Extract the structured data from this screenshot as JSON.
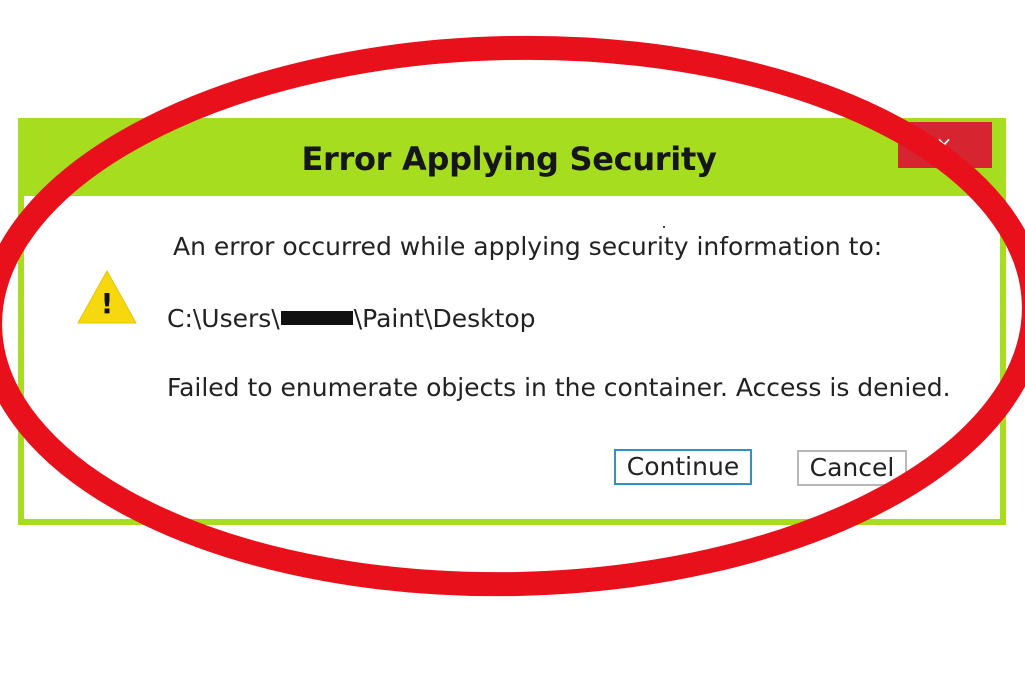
{
  "dialog": {
    "title": "Error Applying Security",
    "close_label": "×",
    "message": "An error occurred while applying security information to:",
    "path_prefix": "C:\\Users\\",
    "path_suffix": "\\Paint\\Desktop",
    "detail": "Failed to enumerate objects in the container. Access is denied.",
    "warning_glyph": "!",
    "buttons": {
      "continue_label": "Continue",
      "cancel_label": "Cancel"
    },
    "icons": {
      "warning": "warning-icon",
      "close": "close-icon"
    }
  },
  "colors": {
    "frame": "#a6de1f",
    "close_button": "#d62430",
    "continue_border": "#2e93c4",
    "cancel_border": "#b8b8b8",
    "annotation_ring": "#e8101a",
    "warning_fill": "#f7d80f"
  }
}
